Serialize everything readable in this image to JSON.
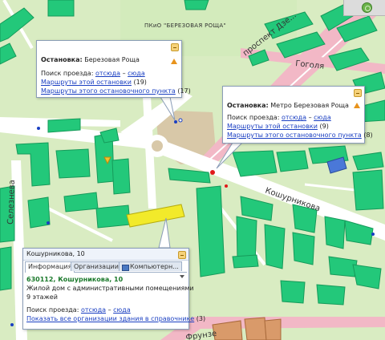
{
  "map": {
    "park_label": "ПКиО \"БЕРЕЗОВАЯ РОЩА\"",
    "streets": {
      "prospect": "проспект Дзе...",
      "gogolya": "Гоголя",
      "kozhurnikova": "Кошурникова",
      "selezneva": "Селезнева",
      "frunze": "Фрунзе"
    }
  },
  "stop_popup_1": {
    "label": "Остановка:",
    "name": "Березовая Роща",
    "route_search_label": "Поиск проезда:",
    "from_here": "отсюда",
    "dash": "–",
    "to_here": "сюда",
    "routes_of_stop_link": "Маршруты этой остановки",
    "routes_of_stop_count": "(19)",
    "routes_of_point_link": "Маршруты этого остановочного пункта",
    "routes_of_point_count": "(17)"
  },
  "stop_popup_2": {
    "label": "Остановка:",
    "name": "Метро Березовая Роща",
    "route_search_label": "Поиск проезда:",
    "from_here": "отсюда",
    "dash": "–",
    "to_here": "сюда",
    "routes_of_stop_link": "Маршруты этой остановки",
    "routes_of_stop_count": "(9)",
    "routes_of_point_link": "Маршруты этого остановочного пункта",
    "routes_of_point_count": "(8)"
  },
  "building_popup": {
    "header": "Кошурникова, 10",
    "tabs": [
      "Информация",
      "Организации",
      "Компьютерн..."
    ],
    "address": "630112, Кошурникова, 10",
    "description_line1": "Жилой дом с административными помещениями",
    "description_line2": "9 этажей",
    "route_search_label": "Поиск проезда:",
    "from_here": "отсюда",
    "dash": "–",
    "to_here": "сюда",
    "orgs_link": "Показать все организации здания в справочнике",
    "orgs_count": "(3)"
  },
  "colors": {
    "background": "#d9ecc2",
    "building": "#23c87a",
    "building_dark": "#169a5a",
    "road": "#ffffff",
    "street_pink": "#f2b8c6",
    "highlighted_building": "#f2ea2a",
    "brick_building": "#d99a6a",
    "sand": "#d8c8a8",
    "link": "#1a3fc2",
    "address_green": "#1c7a2c"
  }
}
